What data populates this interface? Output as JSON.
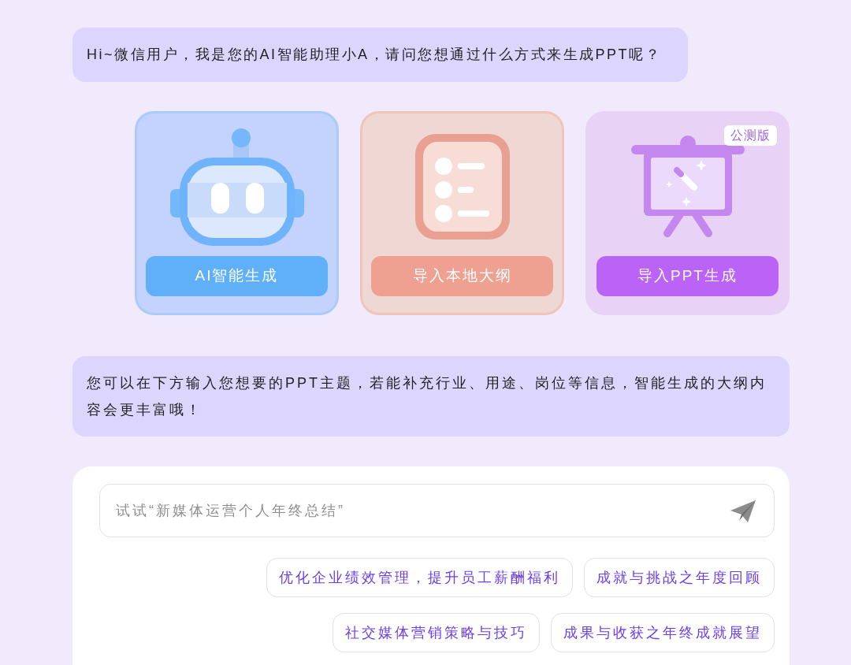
{
  "greeting": {
    "text": "Hi~微信用户，我是您的AI智能助理小A，请问您想通过什么方式来生成PPT呢？"
  },
  "options": [
    {
      "kind": "robot",
      "label": "AI智能生成"
    },
    {
      "kind": "outline",
      "label": "导入本地大纲"
    },
    {
      "kind": "presentation",
      "label": "导入PPT生成",
      "badge": "公测版"
    }
  ],
  "hint": {
    "text": "您可以在下方输入您想要的PPT主题，若能补充行业、用途、岗位等信息，智能生成的大纲内容会更丰富哦！"
  },
  "composer": {
    "placeholder": "试试“新媒体运营个人年终总结”"
  },
  "suggestions": [
    "优化企业绩效管理，提升员工薪酬福利",
    "成就与挑战之年度回顾",
    "社交媒体营销策略与技巧",
    "成果与收获之年终成就展望"
  ]
}
